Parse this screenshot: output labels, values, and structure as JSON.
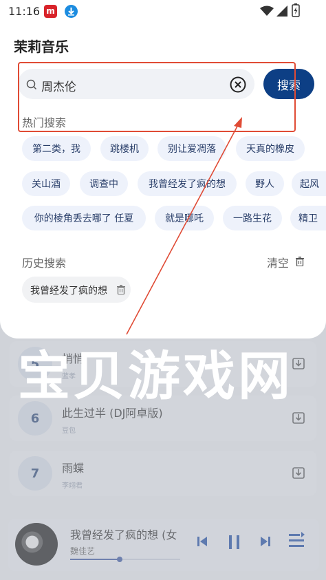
{
  "status_bar": {
    "time": "11:16",
    "app_badge_text": "m"
  },
  "header": {
    "title": "茉莉音乐"
  },
  "search": {
    "value": "周杰伦",
    "button_label": "搜索"
  },
  "hot_search": {
    "label": "热门搜索",
    "rows": [
      [
        "第二类，我",
        "跳楼机",
        "别让爱凋落",
        "天真的橡皮"
      ],
      [
        "关山酒",
        "调查中",
        "我曾经发了疯的想",
        "野人",
        "起风"
      ],
      [
        "你的棱角丢去哪了 任夏",
        "就是哪吒",
        "一路生花",
        "精卫"
      ]
    ]
  },
  "history": {
    "label": "历史搜索",
    "clear_label": "清空",
    "items": [
      "我曾经发了疯的想"
    ]
  },
  "background_list": [
    {
      "num": "5",
      "title": "悄悄",
      "artist": "蓝孝"
    },
    {
      "num": "6",
      "title": "此生过半 (DJ阿卓版)",
      "artist": "豆包"
    },
    {
      "num": "7",
      "title": "雨蝶",
      "artist": "李翊君"
    }
  ],
  "player": {
    "title": "我曾经发了疯的想 (女",
    "artist": "魏佳艺",
    "progress": 0.45
  },
  "watermark": "宝贝游戏网",
  "colors": {
    "accent": "#0d3f85",
    "annotation": "#e04b35",
    "chip_bg": "#eef2fb"
  }
}
